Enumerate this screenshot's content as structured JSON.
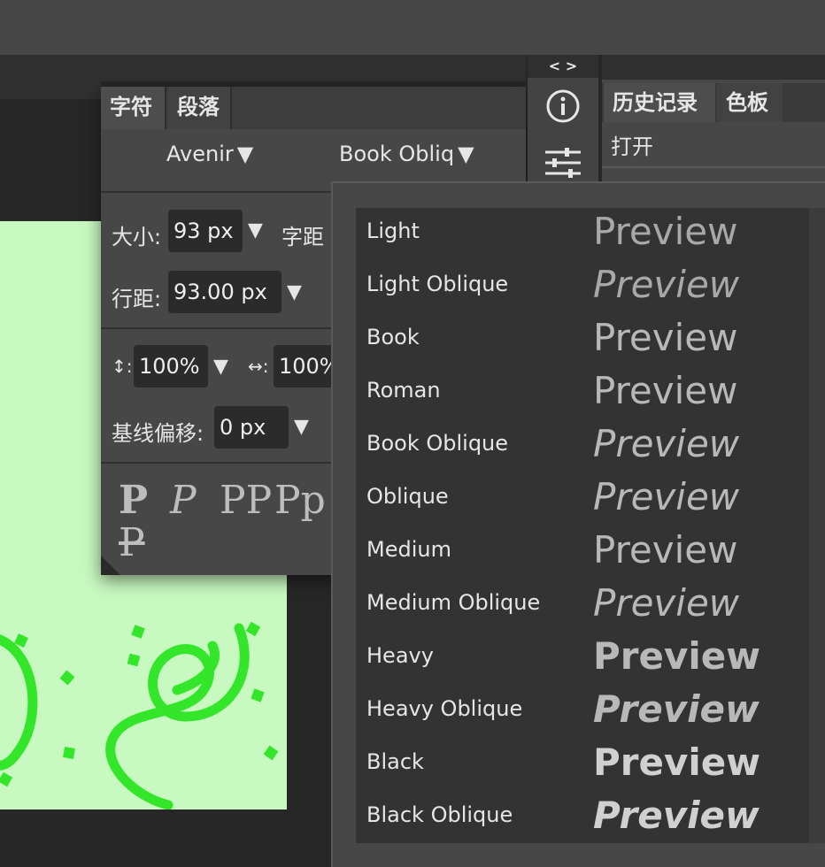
{
  "window": {
    "panel_toggle": "< >"
  },
  "character_panel": {
    "tabs": [
      "字符",
      "段落"
    ],
    "font_family": "Avenir",
    "font_style": "Book Obliq",
    "size_label": "大小:",
    "size_value": "93 px",
    "tracking_label": "字距",
    "leading_label": "行距:",
    "leading_value": "93.00 px",
    "vscale_label": "↕:",
    "vscale_value": "100%",
    "hscale_label": "↔:",
    "hscale_value": "100%",
    "baseline_label": "基线偏移:",
    "baseline_value": "0 px",
    "arrow": "▼",
    "glyph_buttons": [
      "P",
      "P",
      "PP",
      "Pp",
      "P"
    ]
  },
  "history_panel": {
    "tabs": [
      "历史记录",
      "色板"
    ],
    "items": [
      "打开"
    ]
  },
  "style_dropdown": {
    "preview_text": "Preview",
    "styles": [
      {
        "name": "Light"
      },
      {
        "name": "Light Oblique"
      },
      {
        "name": "Book"
      },
      {
        "name": "Roman"
      },
      {
        "name": "Book Oblique"
      },
      {
        "name": "Oblique"
      },
      {
        "name": "Medium"
      },
      {
        "name": "Medium Oblique"
      },
      {
        "name": "Heavy"
      },
      {
        "name": "Heavy Oblique"
      },
      {
        "name": "Black"
      },
      {
        "name": "Black Oblique"
      }
    ]
  },
  "colors": {
    "canvas_bg": "#c8f9c0",
    "artwork": "#33e62a",
    "panel": "#474747"
  },
  "icons": [
    "info-icon",
    "sliders-icon"
  ]
}
